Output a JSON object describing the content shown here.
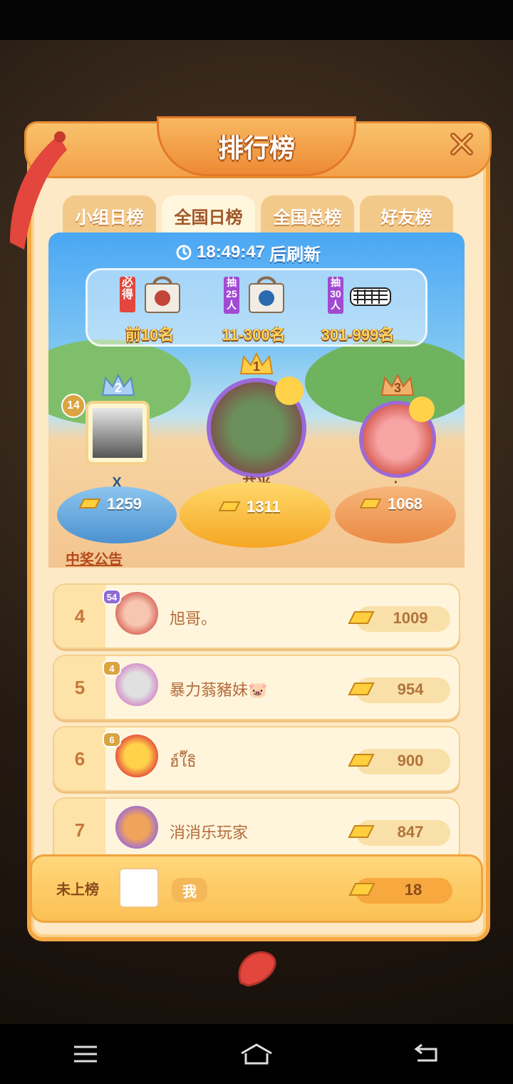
{
  "title": "排行榜",
  "tabs": [
    {
      "label": "小组日榜",
      "active": false
    },
    {
      "label": "全国日榜",
      "active": true
    },
    {
      "label": "全国总榜",
      "active": false
    },
    {
      "label": "好友榜",
      "active": false
    }
  ],
  "countdown": {
    "time": "18:49:47",
    "suffix": "后刷新"
  },
  "prizes": [
    {
      "tag": "必得",
      "label": "前10名"
    },
    {
      "tag": "抽25人",
      "label": "11-300名"
    },
    {
      "tag": "抽30人",
      "label": "301-999名"
    }
  ],
  "podium": {
    "first": {
      "rank": "1",
      "name": "艾米",
      "score": "1311"
    },
    "second": {
      "rank": "2",
      "name": "X",
      "score": "1259",
      "level": "14"
    },
    "third": {
      "rank": "3",
      "name": "·",
      "score": "1068"
    }
  },
  "announcement": "中奖公告",
  "list": [
    {
      "rank": "4",
      "name": "旭哥。",
      "score": "1009",
      "level": "54"
    },
    {
      "rank": "5",
      "name": "暴力蓊豬妹🐷",
      "score": "954",
      "level": "4"
    },
    {
      "rank": "6",
      "name": "ฮ์ใ๊ธิ",
      "score": "900",
      "level": "6"
    },
    {
      "rank": "7",
      "name": "消消乐玩家",
      "score": "847",
      "level": ""
    }
  ],
  "me": {
    "status": "未上榜",
    "name": "我",
    "score": "18"
  },
  "colors": {
    "panel": "#fde9c5",
    "accent": "#f4a843",
    "gold": "#ffd45a"
  },
  "icons": {
    "close": "close-icon",
    "clock": "clock-icon",
    "coin": "gold-bar-icon"
  }
}
